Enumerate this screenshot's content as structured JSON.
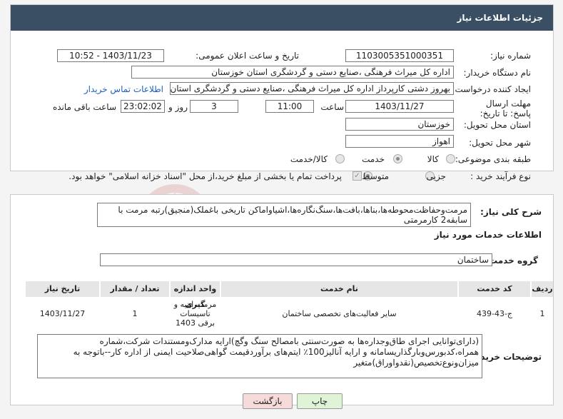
{
  "header": {
    "title": "جزئیات اطلاعات نیاز"
  },
  "fields": {
    "need_number_label": "شماره نیاز:",
    "need_number": "1103005351000351",
    "announce_label": "تاریخ و ساعت اعلان عمومی:",
    "announce_value": "1403/11/23 - 10:52",
    "buyer_label": "نام دستگاه خریدار:",
    "buyer_value": "اداره کل میراث فرهنگی ،صنایع دستی و گردشگری استان خوزستان",
    "creator_label": "ایجاد کننده درخواست:",
    "creator_value": "بهروز دشتی کارپرداز اداره کل میراث فرهنگی ،صنایع دستی و گردشگری استان خوزستان",
    "contact_link": "اطلاعات تماس خریدار",
    "deadline_label": "مهلت ارسال پاسخ: تا تاریخ:",
    "deadline_date": "1403/11/27",
    "time_label": "ساعت",
    "deadline_time": "11:00",
    "days_value": "3",
    "days_label": "روز و",
    "remaining_time": "23:02:02",
    "remaining_label": "ساعت باقی مانده",
    "province_label": "استان محل تحویل:",
    "province_value": "خوزستان",
    "city_label": "شهر محل تحویل:",
    "city_value": "اهواز",
    "category_label": "طبقه بندی موضوعی:",
    "category_options": [
      "کالا",
      "خدمت",
      "کالا/خدمت"
    ],
    "category_selected": "خدمت",
    "process_label": "نوع فرآیند خرید :",
    "process_options": [
      "جزیی",
      "متوسط"
    ],
    "process_selected": "متوسط",
    "payment_note": "پرداخت تمام یا بخشی از مبلغ خرید،از محل \"اسناد خزانه اسلامی\" خواهد بود."
  },
  "summary": {
    "label": "شرح کلی نیاز:",
    "text": "مرمت‌وحفاظت‌محوطه‌ها،بناها،بافت‌ها،سنگ‌نگاره‌ها،اشیاواماکن تاریخی باغملک(منجیق)رتبه مرمت با سابقه2 کارمرمتی"
  },
  "services": {
    "section_title": "اطلاعات خدمات مورد نیاز",
    "group_label": "گروه خدمت:",
    "group_value": "ساختمان",
    "columns": [
      "ردیف",
      "کد خدمت",
      "نام خدمت",
      "واحد اندازه گیری",
      "تعداد / مقدار",
      "تاریخ نیاز"
    ],
    "rows": [
      {
        "index": "1",
        "code": "ج-43-439",
        "name": "سایر فعالیت‌های تخصصی ساختمان",
        "unit": "مرمت ابنیه و تاسیسات برقی 1403",
        "qty": "1",
        "date": "1403/11/27"
      }
    ]
  },
  "buyer_notes": {
    "label": "توضیحات خریدار:",
    "text": "(دارای‌توانایی اجرای طاق‌وجداره‌ها به صورت‌سنتی بامصالح سنگ وگچ)ارایه مدارک‌ومستندات شرکت،شماره همراه،کدبورس‌وبارگذاریسامانه و ارایه آنالیز100٪ ایتم‌های برآوردقیمت گواهی‌صلاحیت ایمنی از اداره کار--باتوجه به میزان‌ونوع‌تخصیص(نقدواوراق)متغیر"
  },
  "buttons": {
    "print": "چاپ",
    "back": "بازگشت"
  },
  "watermark": "AriaTender.net",
  "colors": {
    "header_bg": "#3a4f64",
    "link": "#1f5fbf",
    "print_bg": "#dff3d6",
    "back_bg": "#f7dada"
  }
}
